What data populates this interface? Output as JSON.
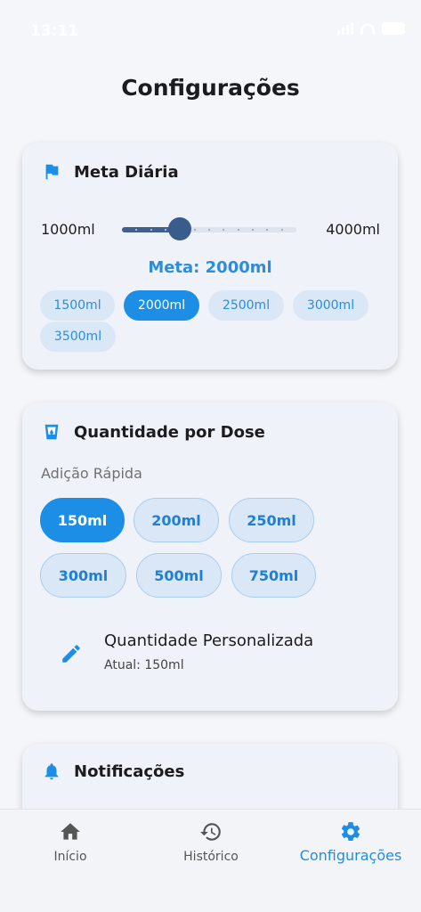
{
  "status": {
    "time": "13:11"
  },
  "page": {
    "title": "Configurações"
  },
  "meta_card": {
    "title": "Meta Diária",
    "min_label": "1000ml",
    "max_label": "4000ml",
    "slider_value_ml": 2000,
    "current_text": "Meta: 2000ml",
    "options": [
      "1500ml",
      "2000ml",
      "2500ml",
      "3000ml",
      "3500ml"
    ],
    "selected": "2000ml"
  },
  "dose_card": {
    "title": "Quantidade por Dose",
    "quick_add_label": "Adição Rápida",
    "options": [
      "150ml",
      "200ml",
      "250ml",
      "300ml",
      "500ml",
      "750ml"
    ],
    "selected": "150ml",
    "custom_title": "Quantidade Personalizada",
    "custom_current": "Atual: 150ml"
  },
  "notifications_card": {
    "title": "Notificações"
  },
  "nav": {
    "items": [
      {
        "label": "Início",
        "icon": "home-icon"
      },
      {
        "label": "Histórico",
        "icon": "history-icon"
      },
      {
        "label": "Configurações",
        "icon": "gear-icon"
      }
    ],
    "active": "Configurações"
  },
  "colors": {
    "accent": "#1d8ee6",
    "slider": "#3a5c8c",
    "chip_bg": "#d9e7f7"
  }
}
